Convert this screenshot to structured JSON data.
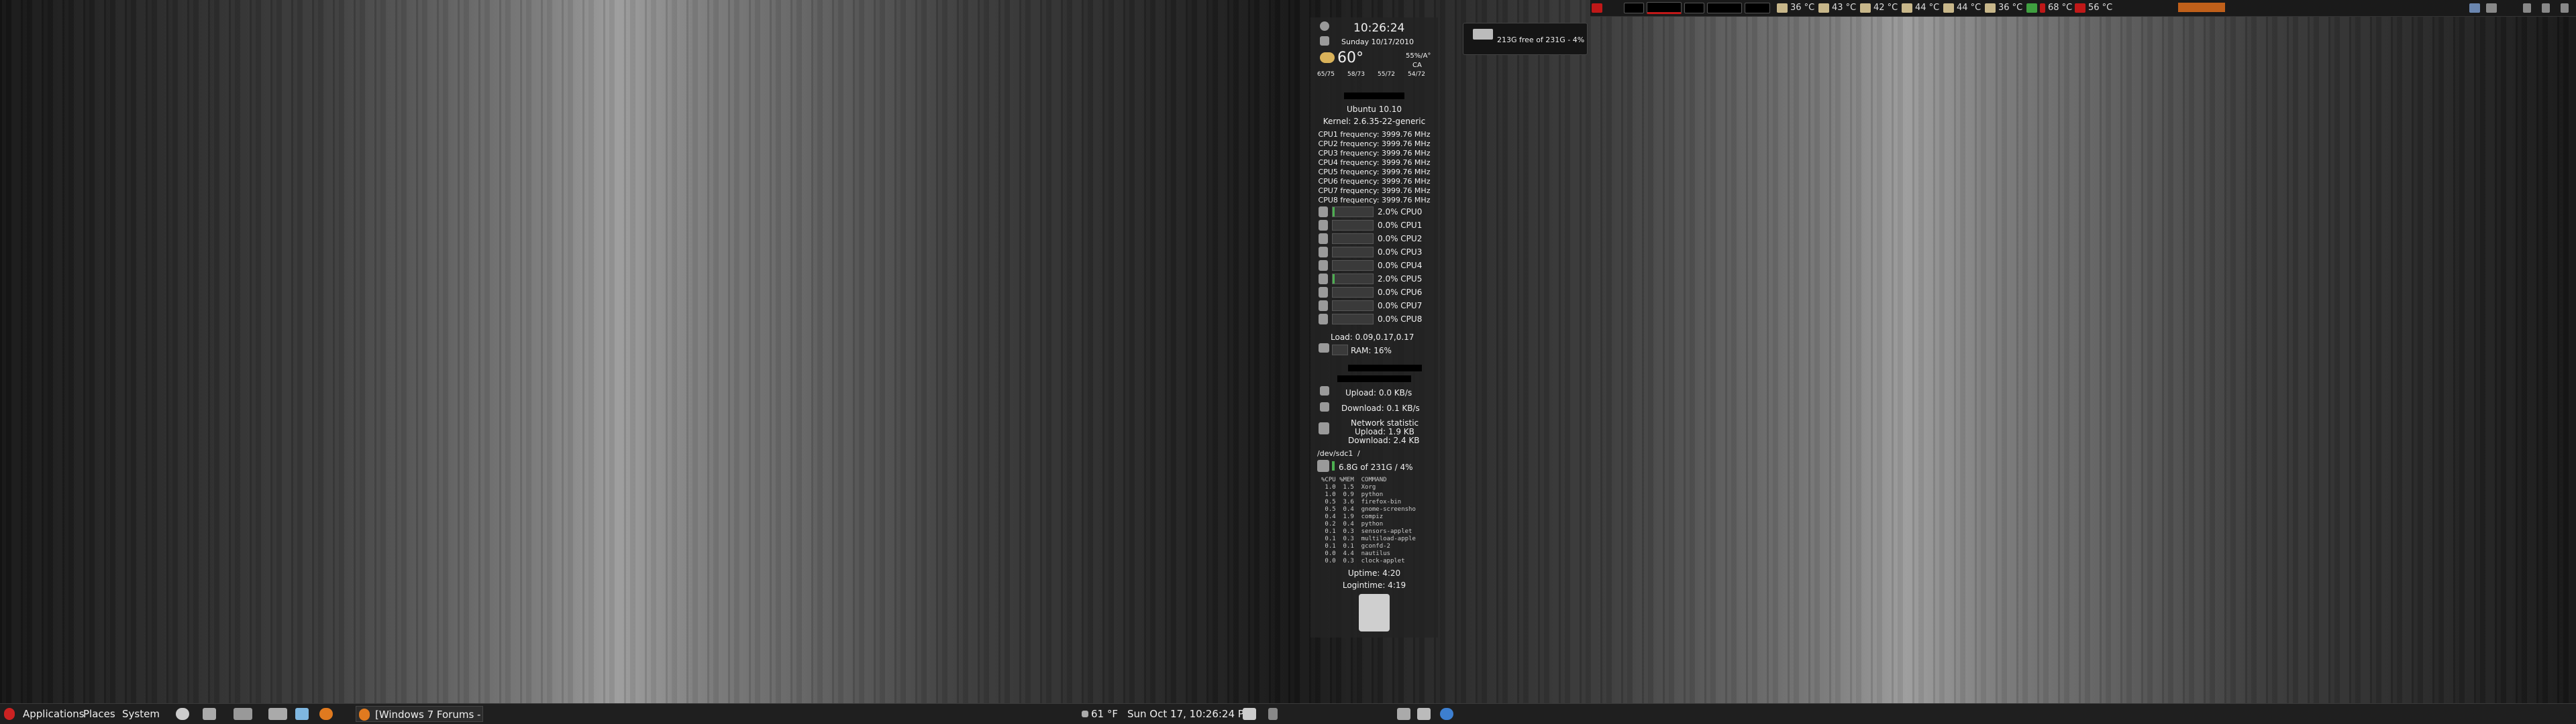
{
  "top_panel": {
    "temps": [
      "36 °C",
      "43 °C",
      "42 °C",
      "44 °C",
      "44 °C",
      "36 °C",
      "68 °C",
      "56 °C"
    ],
    "colors": {
      "panel": "#1a1a1a",
      "accent": "#c0601a",
      "red": "#c01818"
    }
  },
  "disk_widget": {
    "text": "213G free of 231G - 4%"
  },
  "conky": {
    "time": "10:26:24",
    "date": "Sunday 10/17/2010",
    "weather_temp": "60°",
    "weather_extra_1": "55%/A°",
    "weather_extra_2": "CA",
    "forecast": [
      "65/75",
      "58/73",
      "55/72",
      "54/72"
    ],
    "distro": "Ubuntu 10.10",
    "kernel": "Kernel: 2.6.35-22-generic",
    "cpu_freqs": [
      "CPU1 frequency: 3999.76 MHz",
      "CPU2 frequency: 3999.76 MHz",
      "CPU3 frequency: 3999.76 MHz",
      "CPU4 frequency: 3999.76 MHz",
      "CPU5 frequency: 3999.76 MHz",
      "CPU6 frequency: 3999.76 MHz",
      "CPU7 frequency: 3999.76 MHz",
      "CPU8 frequency: 3999.76 MHz"
    ],
    "cpu_usage": [
      {
        "label": "2.0% CPU0",
        "pct": 2
      },
      {
        "label": "0.0% CPU1",
        "pct": 0
      },
      {
        "label": "0.0% CPU2",
        "pct": 0
      },
      {
        "label": "0.0% CPU3",
        "pct": 0
      },
      {
        "label": "0.0% CPU4",
        "pct": 0
      },
      {
        "label": "2.0% CPU5",
        "pct": 2
      },
      {
        "label": "0.0% CPU6",
        "pct": 0
      },
      {
        "label": "0.0% CPU7",
        "pct": 0
      },
      {
        "label": "0.0% CPU8",
        "pct": 0
      }
    ],
    "load": "Load: 0.09,0.17,0.17",
    "ram": "RAM: 16%",
    "upload": "Upload: 0.0 KB/s",
    "download": "Download: 0.1 KB/s",
    "net_title": "Network statistic",
    "net_upload": "Upload: 1.9 KB",
    "net_download": "Download: 2.4 KB",
    "disk_dev": "/dev/sdc1",
    "disk_mount": "/",
    "disk_usage": "6.8G of 231G / 4%",
    "proc_header": "%CPU %MEM  COMMAND",
    "processes": [
      " 1.0  1.5  Xorg",
      " 1.0  0.9  python",
      " 0.5  3.6  firefox-bin",
      " 0.5  0.4  gnome-screensho",
      " 0.4  1.9  compiz",
      " 0.2  0.4  python",
      " 0.1  0.3  sensors-applet",
      " 0.1  0.3  multiload-apple",
      " 0.1  0.1  gconfd-2",
      " 0.0  4.4  nautilus",
      " 0.0  0.3  clock-applet"
    ],
    "uptime": "Uptime: 4:20",
    "logintime": "Logintime: 4:19"
  },
  "bottom_left": {
    "menus": [
      "Applications",
      "Places",
      "System"
    ],
    "task_label": "[Windows 7 Forums - ...",
    "weather": "61 °F",
    "clock": "Sun Oct 17, 10:26:24 PM"
  }
}
